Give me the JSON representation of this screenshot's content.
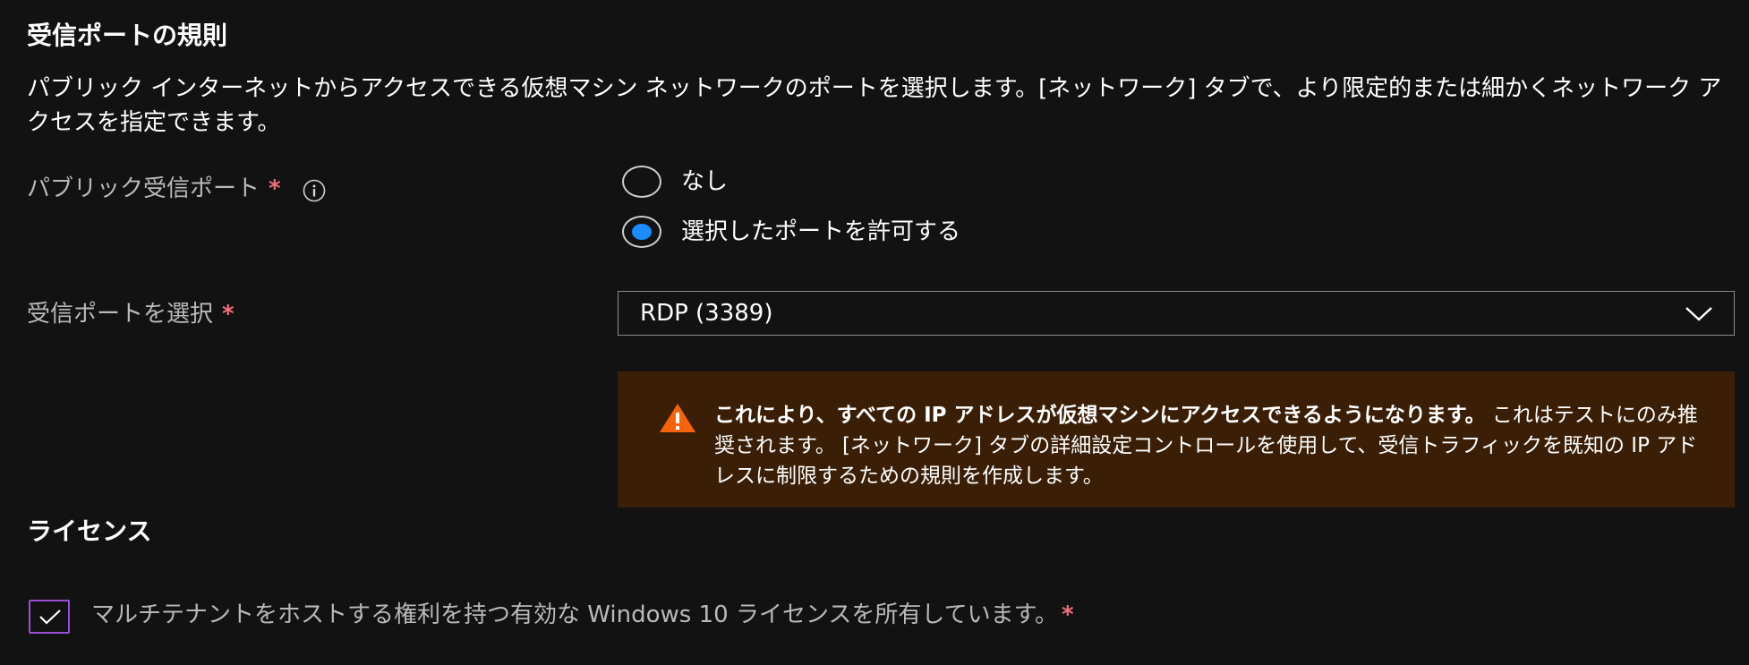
{
  "inbound_rules": {
    "title": "受信ポートの規則",
    "description": "パブリック インターネットからアクセスできる仮想マシン ネットワークのポートを選択します。[ネットワーク] タブで、より限定的または細かくネットワーク アクセスを指定できます。",
    "public_ports": {
      "label": "パブリック受信ポート",
      "required_mark": "*",
      "info_icon": "info-icon",
      "options": [
        {
          "label": "なし",
          "selected": false
        },
        {
          "label": "選択したポートを許可する",
          "selected": true
        }
      ]
    },
    "select_ports": {
      "label": "受信ポートを選択",
      "required_mark": "*",
      "value": "RDP (3389)",
      "chevron_icon": "chevron-down-icon"
    },
    "warning": {
      "icon": "warning-icon",
      "bold_text": "これにより、すべての IP アドレスが仮想マシンにアクセスできるようになります。",
      "text": " これはテストにのみ推奨されます。 [ネットワーク] タブの詳細設定コントロールを使用して、受信トラフィックを既知の IP アドレスに制限するための規則を作成します。",
      "colors": {
        "background": "#3a1f06",
        "icon": "#f7630c"
      }
    }
  },
  "licensing": {
    "title": "ライセンス",
    "checkbox_checked": true,
    "checkbox_label": "マルチテナントをホストする権利を持つ有効な Windows 10 ライセンスを所有しています。",
    "required_mark": "*"
  },
  "colors": {
    "background": "#121212",
    "accent": "#1a8cff",
    "required": "#f1707b",
    "checkbox_border": "#9b4fd6"
  }
}
